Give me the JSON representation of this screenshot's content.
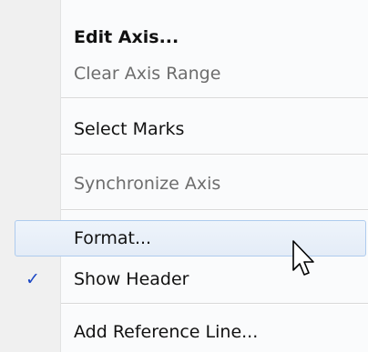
{
  "menu": {
    "items": [
      {
        "label": "Edit Axis..."
      },
      {
        "label": "Clear Axis Range"
      },
      {
        "label": "Select Marks"
      },
      {
        "label": "Synchronize Axis"
      },
      {
        "label": "Format..."
      },
      {
        "label": "Show Header",
        "checked": true,
        "check_glyph": "✓"
      },
      {
        "label": "Add Reference Line..."
      }
    ]
  },
  "icons": {
    "check": "check-icon",
    "cursor": "arrow-cursor-icon"
  },
  "colors": {
    "check_mark": "#1b47c4",
    "hover_border": "#aecbee",
    "disabled_text": "#6d6d6d"
  }
}
